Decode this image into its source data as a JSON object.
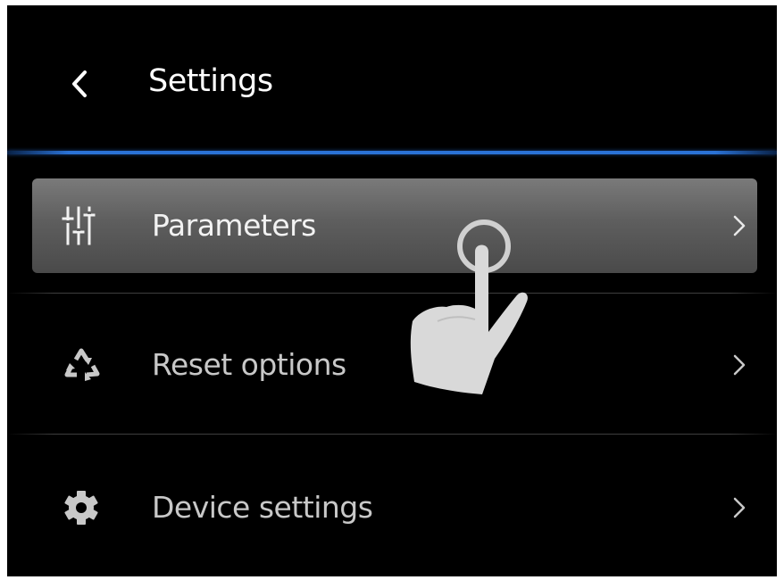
{
  "header": {
    "title": "Settings",
    "back_icon": "chevron-left-icon"
  },
  "menu": {
    "items": [
      {
        "label": "Parameters",
        "icon": "sliders-icon",
        "chevron": "chevron-right-icon",
        "selected": true
      },
      {
        "label": "Reset options",
        "icon": "recycle-icon",
        "chevron": "chevron-right-icon",
        "selected": false
      },
      {
        "label": "Device settings",
        "icon": "gear-icon",
        "chevron": "chevron-right-icon",
        "selected": false
      }
    ]
  },
  "overlay": {
    "icon": "tap-gesture-icon"
  },
  "colors": {
    "background": "#000000",
    "accent": "#2a72d6",
    "selected_row": "#5e5e5e",
    "text": "#c8c8c8"
  }
}
